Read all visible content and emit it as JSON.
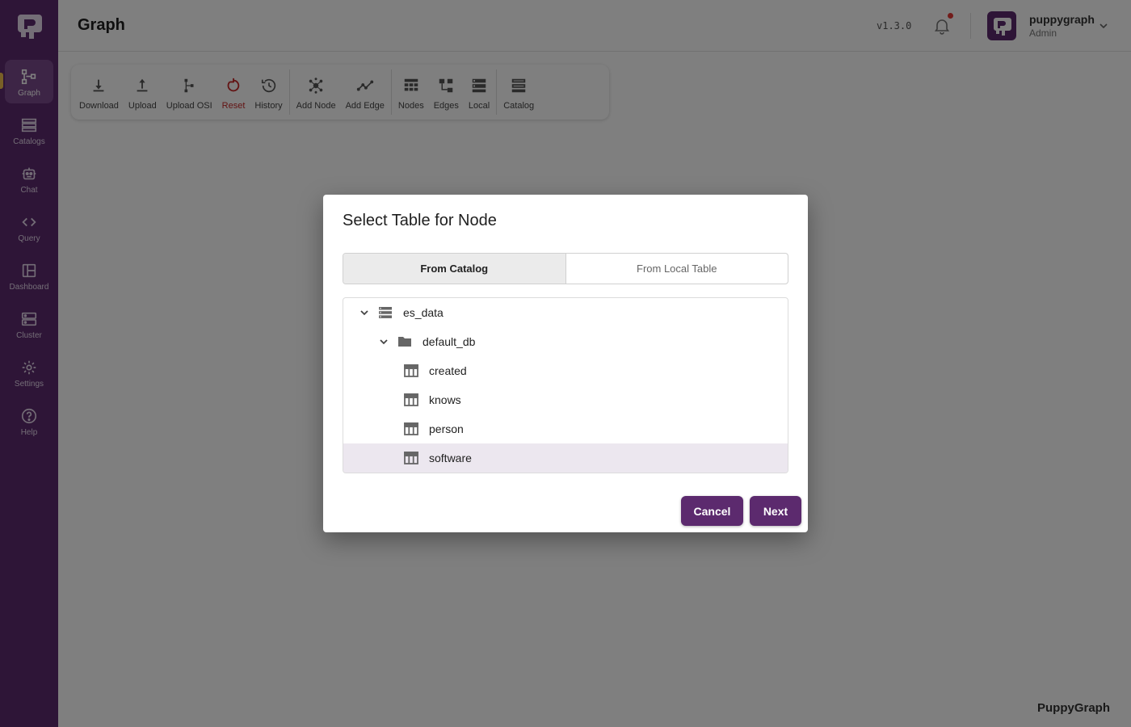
{
  "sidebar": {
    "items": [
      {
        "label": "Graph",
        "icon": "graph-icon",
        "active": true
      },
      {
        "label": "Catalogs",
        "icon": "catalogs-icon"
      },
      {
        "label": "Chat",
        "icon": "robot-icon"
      },
      {
        "label": "Query",
        "icon": "code-icon"
      },
      {
        "label": "Dashboard",
        "icon": "dashboard-icon"
      },
      {
        "label": "Cluster",
        "icon": "cluster-icon"
      },
      {
        "label": "Settings",
        "icon": "gear-icon"
      },
      {
        "label": "Help",
        "icon": "help-icon"
      }
    ]
  },
  "header": {
    "title": "Graph",
    "version": "v1.3.0",
    "user": {
      "name": "puppygraph",
      "role": "Admin"
    }
  },
  "toolbar": {
    "buttons": [
      {
        "label": "Download",
        "icon": "download-icon"
      },
      {
        "label": "Upload",
        "icon": "upload-icon"
      },
      {
        "label": "Upload OSI",
        "icon": "upload-osi-icon"
      },
      {
        "label": "Reset",
        "icon": "reset-icon"
      },
      {
        "label": "History",
        "icon": "history-icon"
      },
      {
        "label": "Add Node",
        "icon": "add-node-icon"
      },
      {
        "label": "Add Edge",
        "icon": "add-edge-icon"
      },
      {
        "label": "Nodes",
        "icon": "nodes-icon"
      },
      {
        "label": "Edges",
        "icon": "edges-icon"
      },
      {
        "label": "Local",
        "icon": "local-icon"
      },
      {
        "label": "Catalog",
        "icon": "catalog-icon"
      }
    ]
  },
  "dialog": {
    "title": "Select Table for Node",
    "tabs": [
      "From Catalog",
      "From Local Table"
    ],
    "active_tab": "From Catalog",
    "tree": {
      "catalog": "es_data",
      "database": "default_db",
      "tables": [
        "created",
        "knows",
        "person",
        "software"
      ],
      "selected": "software"
    },
    "cancel_label": "Cancel",
    "next_label": "Next"
  },
  "footer": {
    "brand": "PuppyGraph"
  },
  "colors": {
    "primary": "#5c2a6e",
    "sidebar": "#5c2a6e",
    "danger": "#c62828",
    "notification": "#e53935"
  }
}
